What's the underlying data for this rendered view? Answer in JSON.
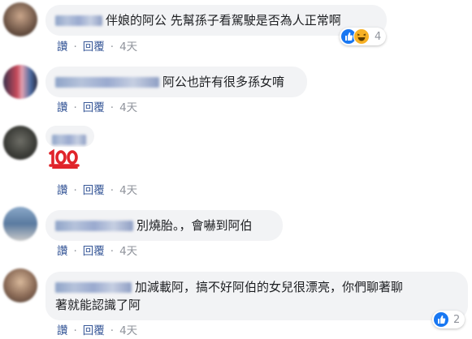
{
  "comments": [
    {
      "text": "伴娘的阿公 先幫孫子看駕駛是否為人正常啊",
      "actions": {
        "like": "讚",
        "reply": "回覆",
        "time": "4天"
      },
      "reactions": {
        "icons": [
          "like-icon",
          "haha-icon"
        ],
        "count": "4"
      }
    },
    {
      "text": "阿公也許有很多孫女唷",
      "actions": {
        "like": "讚",
        "reply": "回覆",
        "time": "4天"
      }
    },
    {
      "text": "💯",
      "actions": {
        "like": "讚",
        "reply": "回覆",
        "time": "4天"
      }
    },
    {
      "text": "別燒胎。，會嚇到阿伯",
      "actions": {
        "like": "讚",
        "reply": "回覆",
        "time": "4天"
      }
    },
    {
      "text_line1": "加減載阿，搞不好阿伯的女兒很漂亮，你們聊著聊",
      "text_line2": "著就能認識了阿",
      "actions": {
        "like": "讚",
        "reply": "回覆",
        "time": "4天"
      },
      "reactions": {
        "icons": [
          "like-icon"
        ],
        "count": "2"
      }
    }
  ],
  "separator": "·",
  "colors": {
    "link": "#385898",
    "meta": "#90949c",
    "bubble": "#f2f3f5",
    "like": "#1877f2",
    "haha": "#f7b125"
  }
}
